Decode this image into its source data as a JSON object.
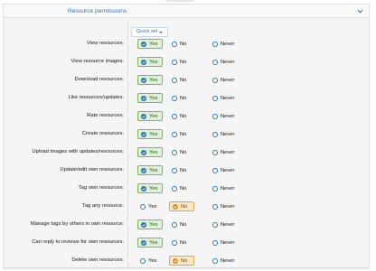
{
  "section": {
    "title": "Resource permissions"
  },
  "quick_set": {
    "label": "Quick set"
  },
  "options": {
    "yes": "Yes",
    "no": "No",
    "never": "Never"
  },
  "permissions": [
    {
      "label": "View resources:",
      "value": "yes"
    },
    {
      "label": "View resource images:",
      "value": "yes"
    },
    {
      "label": "Download resources:",
      "value": "yes"
    },
    {
      "label": "Like resources/updates:",
      "value": "yes"
    },
    {
      "label": "Rate resources:",
      "value": "yes"
    },
    {
      "label": "Create resources:",
      "value": "yes"
    },
    {
      "label": "Upload images with updates/resources:",
      "value": "yes"
    },
    {
      "label": "Update/edit own resources:",
      "value": "yes"
    },
    {
      "label": "Tag own resources:",
      "value": "yes"
    },
    {
      "label": "Tag any resource:",
      "value": "no"
    },
    {
      "label": "Manage tags by others in own resource:",
      "value": "yes"
    },
    {
      "label": "Can reply to reviews for own resources:",
      "value": "yes"
    },
    {
      "label": "Delete own resources:",
      "value": "no"
    }
  ],
  "colors": {
    "accent": "#2577b1",
    "yes_bg": "#dff0d8",
    "no_bg": "#fbe6c7"
  }
}
